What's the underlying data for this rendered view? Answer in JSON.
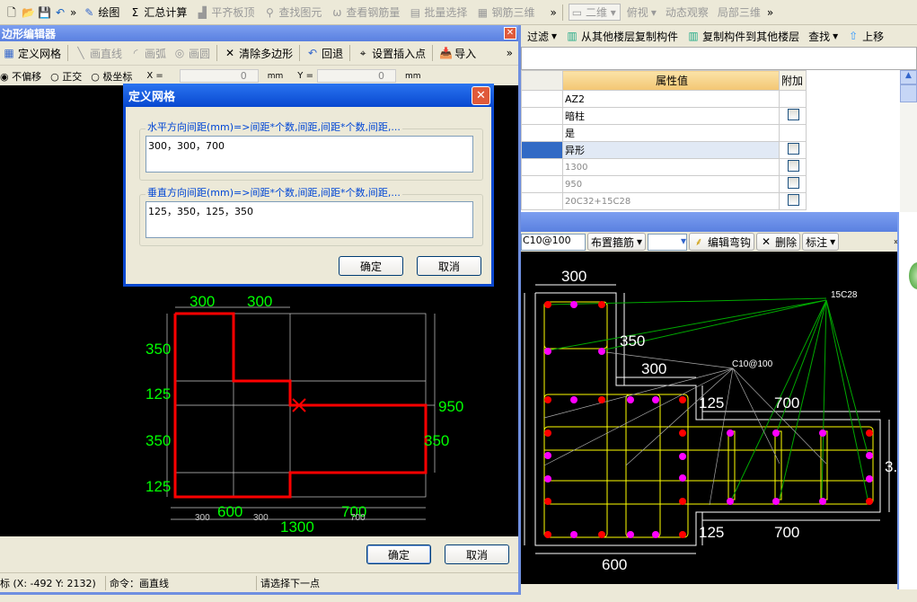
{
  "main_toolbar": {
    "items": [
      {
        "label": "绘图",
        "icon": "draw-icon"
      },
      {
        "label": "汇总计算",
        "icon": "sigma-icon"
      },
      {
        "label": "平齐板顶",
        "icon": "align-icon",
        "disabled": true
      },
      {
        "label": "查找图元",
        "icon": "binoculars-icon",
        "disabled": true
      },
      {
        "label": "查看钢筋量",
        "icon": "rebar-icon",
        "disabled": true
      },
      {
        "label": "批量选择",
        "icon": "batch-icon",
        "disabled": true
      },
      {
        "label": "钢筋三维",
        "icon": "3d-icon",
        "disabled": true
      }
    ],
    "view_select": "二维",
    "view_items": [
      "俯视",
      "动态观察",
      "局部三维"
    ]
  },
  "secondary_toolbar": {
    "items": [
      "过滤",
      "从其他楼层复制构件",
      "复制构件到其他楼层",
      "查找",
      "上移"
    ]
  },
  "properties": {
    "header_value": "属性值",
    "header_extra": "附加",
    "rows": [
      {
        "value": "AZ2",
        "check": false,
        "gray": false
      },
      {
        "value": "暗柱",
        "check": true,
        "gray": false
      },
      {
        "value": "是",
        "check": false,
        "gray": false
      },
      {
        "value": "异形",
        "check": true,
        "gray": false,
        "selected": true
      },
      {
        "value": "1300",
        "check": true,
        "gray": true
      },
      {
        "value": "950",
        "check": true,
        "gray": true
      },
      {
        "value": "20C32+15C28",
        "check": true,
        "gray": true
      }
    ]
  },
  "section_toolbar": {
    "stirrup_input": "C10@100",
    "items": [
      "布置箍筋",
      "编辑弯钩",
      "删除",
      "标注"
    ]
  },
  "section_drawing": {
    "labels": [
      "300",
      "350",
      "300",
      "125",
      "700",
      "125",
      "700",
      "600",
      "3.",
      "15C28",
      "C10@100"
    ]
  },
  "editor": {
    "title": "边形编辑器",
    "toolbar": [
      {
        "label": "定义网格",
        "disabled": false
      },
      {
        "label": "画直线",
        "disabled": true
      },
      {
        "label": "画弧",
        "disabled": true
      },
      {
        "label": "画圆",
        "disabled": true
      },
      {
        "label": "清除多边形",
        "disabled": false
      },
      {
        "label": "回退",
        "disabled": false
      },
      {
        "label": "设置插入点",
        "disabled": false
      },
      {
        "label": "导入",
        "disabled": false
      }
    ],
    "options": {
      "radios": [
        "不偏移",
        "正交",
        "极坐标"
      ],
      "selected": "不偏移",
      "x_label": "X =",
      "x_value": "0",
      "y_label": "Y =",
      "y_value": "0",
      "unit": "mm"
    },
    "drawing": {
      "top_dims": [
        "300",
        "300"
      ],
      "left_dims": [
        "350",
        "125",
        "350",
        "125"
      ],
      "right_dims": [
        "950",
        "350"
      ],
      "bottom_dims": [
        "300",
        "600",
        "300",
        "700",
        "700"
      ],
      "total": "1300"
    },
    "ok": "确定",
    "cancel": "取消",
    "status": {
      "coords": "标 (X: -492 Y: 2132)",
      "command": "命令：画直线",
      "prompt": "请选择下一点"
    }
  },
  "grid_dialog": {
    "title": "定义网格",
    "horizontal_label": "水平方向间距(mm)=>间距*个数,间距,间距*个数,间距,...",
    "horizontal_value": "300，300，700",
    "vertical_label": "垂直方向间距(mm)=>间距*个数,间距,间距*个数,间距,...",
    "vertical_value": "125，350，125，350",
    "ok": "确定",
    "cancel": "取消"
  },
  "colors": {
    "title_bar": "#1a4fc8",
    "polygon": "#ff0000",
    "dims": "#00ff00",
    "stirrup": "#ffff00",
    "rebar_corner": "#ff0000",
    "rebar_mid": "#ff00ff"
  }
}
